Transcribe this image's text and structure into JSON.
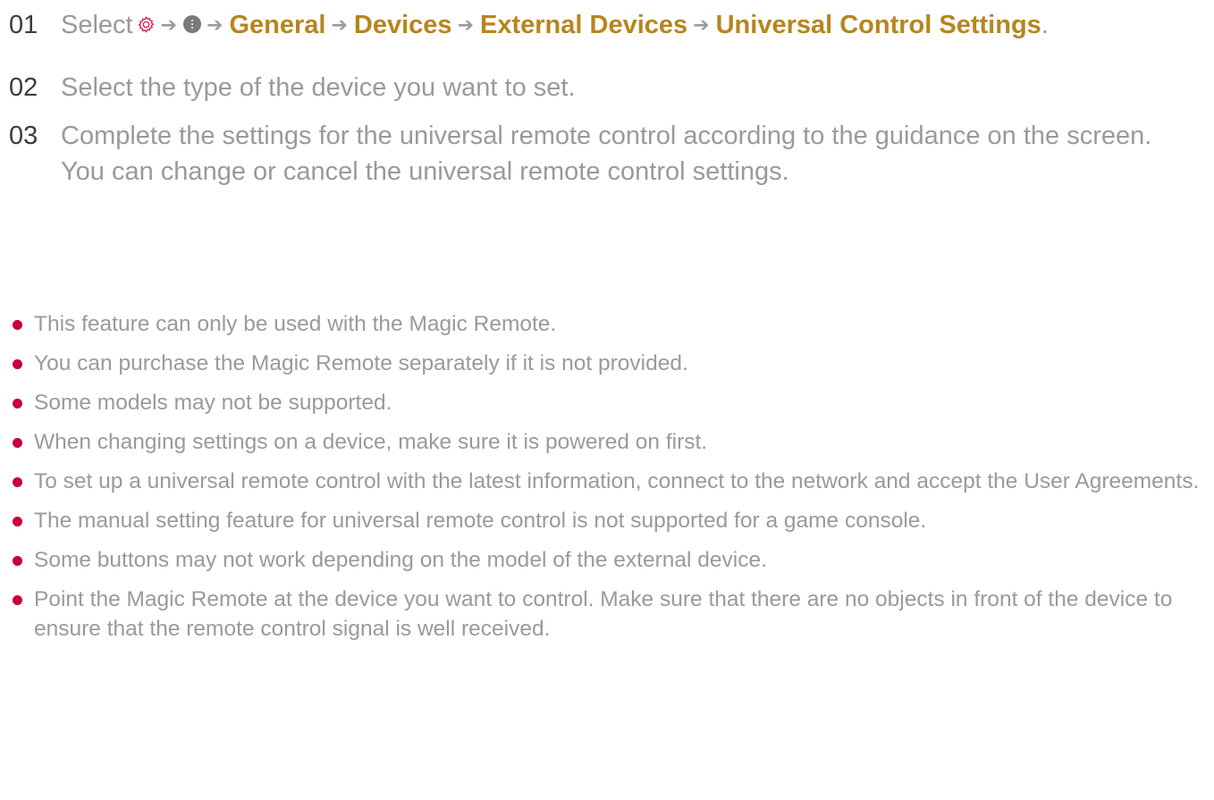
{
  "steps": [
    {
      "number": "01",
      "prefix": "Select",
      "icons": [
        "gear-icon",
        "more-icon"
      ],
      "path": [
        "General",
        "Devices",
        "External Devices",
        "Universal Control Settings"
      ],
      "suffix": "."
    },
    {
      "number": "02",
      "text": "Select the type of the device you want to set."
    },
    {
      "number": "03",
      "text": "Complete the settings for the universal remote control according to the guidance on the screen.",
      "note": "You can change or cancel the universal remote control settings."
    }
  ],
  "arrow_glyph": "➔",
  "notes": [
    "This feature can only be used with the Magic Remote.",
    "You can purchase the Magic Remote separately if it is not provided.",
    "Some models may not be supported.",
    "When changing settings on a device, make sure it is powered on first.",
    "To set up a universal remote control with the latest information, connect to the network and accept the User Agreements.",
    "The manual setting feature for universal remote control is not supported for a game console.",
    "Some buttons may not work depending on the model of the external device.",
    "Point the Magic Remote at the device you want to control. Make sure that there are no objects in front of the device to ensure that the remote control signal is well received."
  ],
  "colors": {
    "menu_path": "#b6861d",
    "bullet": "#c8003a",
    "body_text": "#9a9a9a",
    "step_number": "#3c3c3c",
    "gear_icon": "#d6204a"
  }
}
